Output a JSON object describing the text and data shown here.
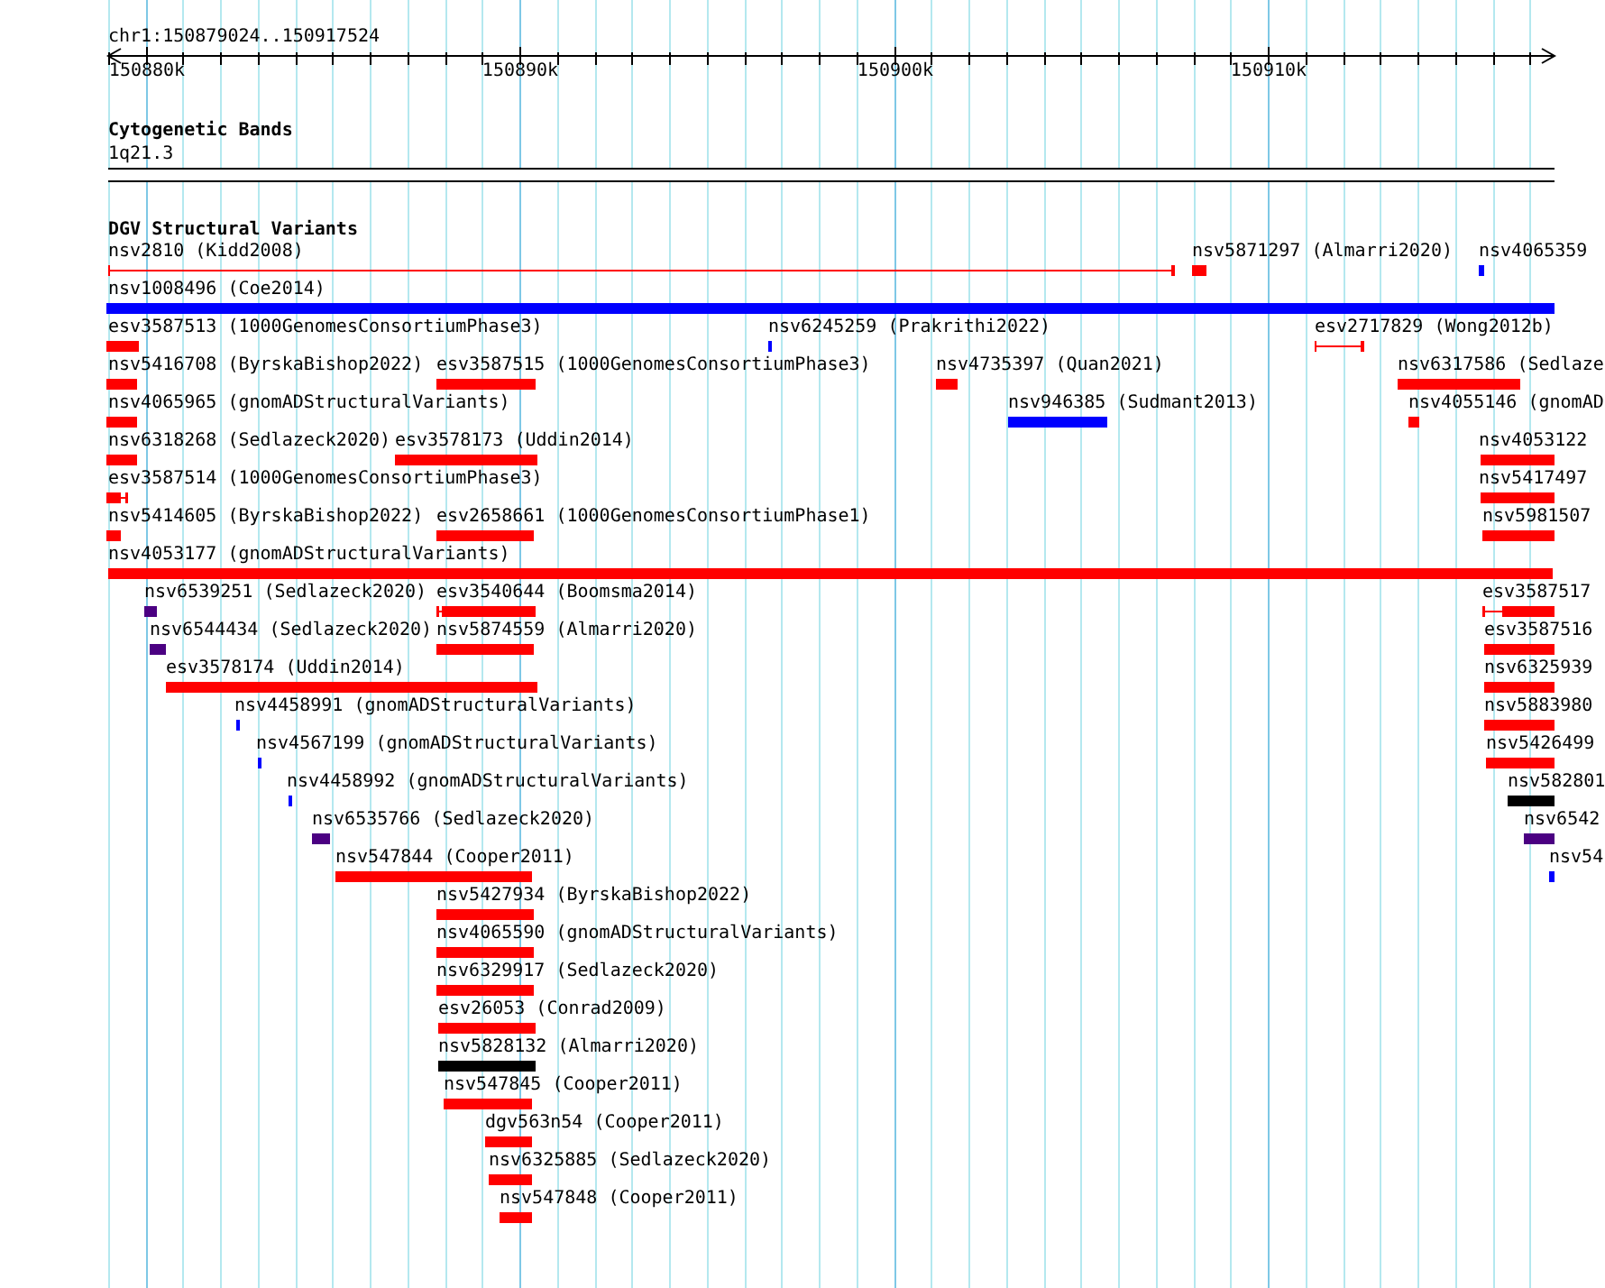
{
  "location": "chr1:150879024..150917524",
  "ruler": {
    "ticks": [
      "150880k",
      "150890k",
      "150900k",
      "150910k"
    ]
  },
  "cytogenetic_bands": {
    "title": "Cytogenetic Bands",
    "band": "1q21.3"
  },
  "structural_variants": {
    "title": "DGV Structural Variants",
    "features": [
      {
        "label": "nsv2810 (Kidd2008)",
        "color": "#ff0000",
        "kind": "span"
      },
      {
        "label": "nsv5871297 (Almarri2020)",
        "color": "#ff0000",
        "kind": "bar"
      },
      {
        "label": "nsv4065359",
        "color": "#0000ff",
        "kind": "bar"
      },
      {
        "label": "nsv1008496 (Coe2014)",
        "color": "#0000ff",
        "kind": "bar"
      },
      {
        "label": "esv3587513 (1000GenomesConsortiumPhase3)",
        "color": "#ff0000",
        "kind": "bar"
      },
      {
        "label": "nsv6245259 (Prakrithi2022)",
        "color": "#0000ff",
        "kind": "bar"
      },
      {
        "label": "esv2717829 (Wong2012b)",
        "color": "#ff0000",
        "kind": "span"
      },
      {
        "label": "nsv5416708 (ByrskaBishop2022)",
        "color": "#ff0000",
        "kind": "bar"
      },
      {
        "label": "esv3587515 (1000GenomesConsortiumPhase3)",
        "color": "#ff0000",
        "kind": "bar"
      },
      {
        "label": "nsv4735397 (Quan2021)",
        "color": "#ff0000",
        "kind": "bar"
      },
      {
        "label": "nsv6317586 (Sedlaze",
        "color": "#ff0000",
        "kind": "bar"
      },
      {
        "label": "nsv4065965 (gnomADStructuralVariants)",
        "color": "#ff0000",
        "kind": "bar"
      },
      {
        "label": "nsv946385 (Sudmant2013)",
        "color": "#0000ff",
        "kind": "bar"
      },
      {
        "label": "nsv4055146 (gnomAD",
        "color": "#ff0000",
        "kind": "bar"
      },
      {
        "label": "nsv6318268 (Sedlazeck2020)",
        "color": "#ff0000",
        "kind": "bar"
      },
      {
        "label": "esv3578173 (Uddin2014)",
        "color": "#ff0000",
        "kind": "bar"
      },
      {
        "label": "nsv4053122",
        "color": "#ff0000",
        "kind": "bar"
      },
      {
        "label": "esv3587514 (1000GenomesConsortiumPhase3)",
        "color": "#ff0000",
        "kind": "split"
      },
      {
        "label": "nsv5417497",
        "color": "#ff0000",
        "kind": "bar"
      },
      {
        "label": "nsv5414605 (ByrskaBishop2022)",
        "color": "#ff0000",
        "kind": "bar"
      },
      {
        "label": "esv2658661 (1000GenomesConsortiumPhase1)",
        "color": "#ff0000",
        "kind": "bar"
      },
      {
        "label": "nsv5981507",
        "color": "#ff0000",
        "kind": "bar"
      },
      {
        "label": "nsv4053177 (gnomADStructuralVariants)",
        "color": "#ff0000",
        "kind": "bar"
      },
      {
        "label": "nsv6539251 (Sedlazeck2020)",
        "color": "#4b0082",
        "kind": "bar"
      },
      {
        "label": "esv3540644 (Boomsma2014)",
        "color": "#ff0000",
        "kind": "split"
      },
      {
        "label": "esv3587517",
        "color": "#ff0000",
        "kind": "split"
      },
      {
        "label": "nsv6544434 (Sedlazeck2020)",
        "color": "#4b0082",
        "kind": "bar"
      },
      {
        "label": "nsv5874559 (Almarri2020)",
        "color": "#ff0000",
        "kind": "bar"
      },
      {
        "label": "esv3587516",
        "color": "#ff0000",
        "kind": "bar"
      },
      {
        "label": "esv3578174 (Uddin2014)",
        "color": "#ff0000",
        "kind": "bar"
      },
      {
        "label": "nsv6325939",
        "color": "#ff0000",
        "kind": "bar"
      },
      {
        "label": "nsv4458991 (gnomADStructuralVariants)",
        "color": "#0000ff",
        "kind": "bar"
      },
      {
        "label": "nsv5883980",
        "color": "#ff0000",
        "kind": "bar"
      },
      {
        "label": "nsv4567199 (gnomADStructuralVariants)",
        "color": "#0000ff",
        "kind": "bar"
      },
      {
        "label": "nsv5426499",
        "color": "#ff0000",
        "kind": "bar"
      },
      {
        "label": "nsv4458992 (gnomADStructuralVariants)",
        "color": "#0000ff",
        "kind": "bar"
      },
      {
        "label": "nsv582801",
        "color": "#000000",
        "kind": "bar"
      },
      {
        "label": "nsv6535766 (Sedlazeck2020)",
        "color": "#4b0082",
        "kind": "bar"
      },
      {
        "label": "nsv6542",
        "color": "#4b0082",
        "kind": "bar"
      },
      {
        "label": "nsv547844 (Cooper2011)",
        "color": "#ff0000",
        "kind": "bar"
      },
      {
        "label": "nsv54",
        "color": "#0000ff",
        "kind": "bar"
      },
      {
        "label": "nsv5427934 (ByrskaBishop2022)",
        "color": "#ff0000",
        "kind": "bar"
      },
      {
        "label": "nsv4065590 (gnomADStructuralVariants)",
        "color": "#ff0000",
        "kind": "bar"
      },
      {
        "label": "nsv6329917 (Sedlazeck2020)",
        "color": "#ff0000",
        "kind": "bar"
      },
      {
        "label": "esv26053 (Conrad2009)",
        "color": "#ff0000",
        "kind": "bar"
      },
      {
        "label": "nsv5828132 (Almarri2020)",
        "color": "#000000",
        "kind": "bar"
      },
      {
        "label": "nsv547845 (Cooper2011)",
        "color": "#ff0000",
        "kind": "bar"
      },
      {
        "label": "dgv563n54 (Cooper2011)",
        "color": "#ff0000",
        "kind": "bar"
      },
      {
        "label": "nsv6325885 (Sedlazeck2020)",
        "color": "#ff0000",
        "kind": "bar"
      },
      {
        "label": "nsv547848 (Cooper2011)",
        "color": "#ff0000",
        "kind": "bar"
      }
    ]
  }
}
